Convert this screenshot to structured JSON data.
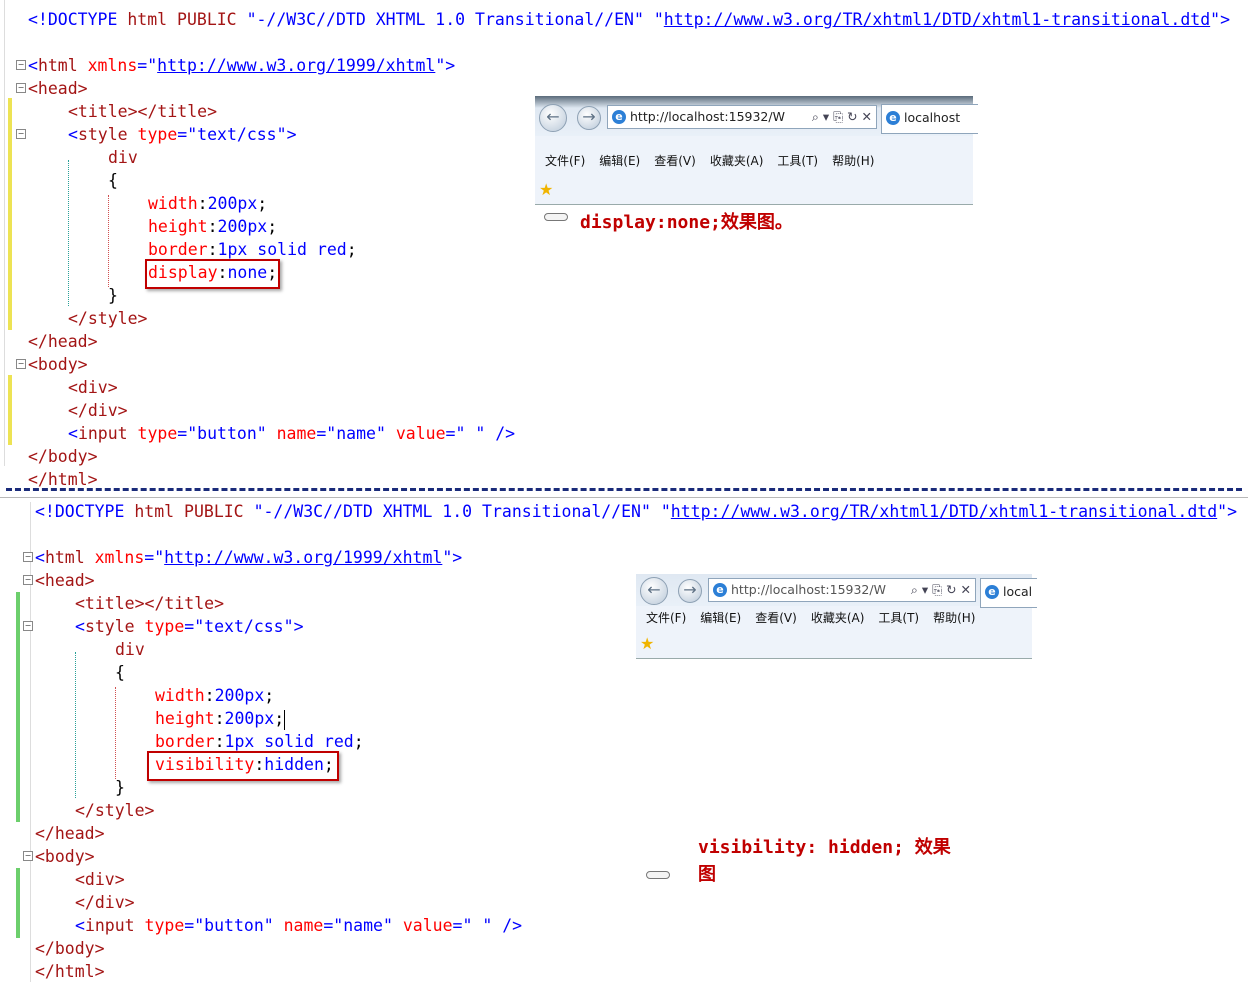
{
  "top": {
    "doctype": {
      "open": "<!DOCTYPE ",
      "html": "html ",
      "public": "PUBLIC ",
      "fpi": "\"-//W3C//DTD XHTML 1.0 Transitional//EN\"",
      "sp": " ",
      "q1": "\"",
      "dtd": "http://www.w3.org/TR/xhtml1/DTD/xhtml1-transitional.dtd",
      "q2": "\"",
      "close": ">"
    },
    "html_open": {
      "lt": "<",
      "tag": "html",
      "attr": " xmlns",
      "eq": "=\"",
      "url": "http://www.w3.org/1999/xhtml",
      "q": "\"",
      "gt": ">"
    },
    "head_open": "<head>",
    "title_line": "<title></title>",
    "style_open": {
      "lt": "<",
      "tag": "style",
      "attr": " type",
      "val": "=\"text/css\"",
      "gt": ">"
    },
    "selector": "div",
    "brace_open": "{",
    "props": [
      {
        "name": "width",
        "colon": ":",
        "value": "200px",
        "semi": ";"
      },
      {
        "name": "height",
        "colon": ":",
        "value": "200px",
        "semi": ";"
      },
      {
        "name": "border",
        "colon": ":",
        "value": "1px solid red",
        "semi": ";"
      }
    ],
    "highlight": {
      "name": "display",
      "colon": ":",
      "value": "none",
      "semi": ";"
    },
    "brace_close": "}",
    "style_close": "</style>",
    "head_close": "</head>",
    "body_open": "<body>",
    "div_open": "<div>",
    "div_close": "</div>",
    "input_line": {
      "lt": "<",
      "tag": "input",
      "a1": " type",
      "v1": "=\"button\"",
      "a2": " name",
      "v2": "=\"name\"",
      "a3": " value",
      "v3": "=\" \"",
      "end": " />"
    },
    "body_close": "</body>",
    "html_close": "</html>",
    "note": "display:none;效果图。"
  },
  "bottom": {
    "highlight": {
      "name": "visibility",
      "colon": ":",
      "value": "hidden",
      "semi": ";"
    },
    "note_line1": "visibility: hidden; 效果",
    "note_line2": "图"
  },
  "browser1": {
    "url": "http://localhost:15932/W",
    "tab": "localhost",
    "menu": [
      "文件(F)",
      "编辑(E)",
      "查看(V)",
      "收藏夹(A)",
      "工具(T)",
      "帮助(H)"
    ]
  },
  "browser2": {
    "url": "http://localhost:15932/W",
    "tab": "local",
    "menu": [
      "文件(F)",
      "编辑(E)",
      "查看(V)",
      "收藏夹(A)",
      "工具(T)",
      "帮助(H)"
    ]
  },
  "colors": {
    "keyword": "#0000ff",
    "tag": "#a31515",
    "attr": "#ff0000",
    "highlight_box": "#c00000",
    "divider": "#1a2b7a"
  }
}
